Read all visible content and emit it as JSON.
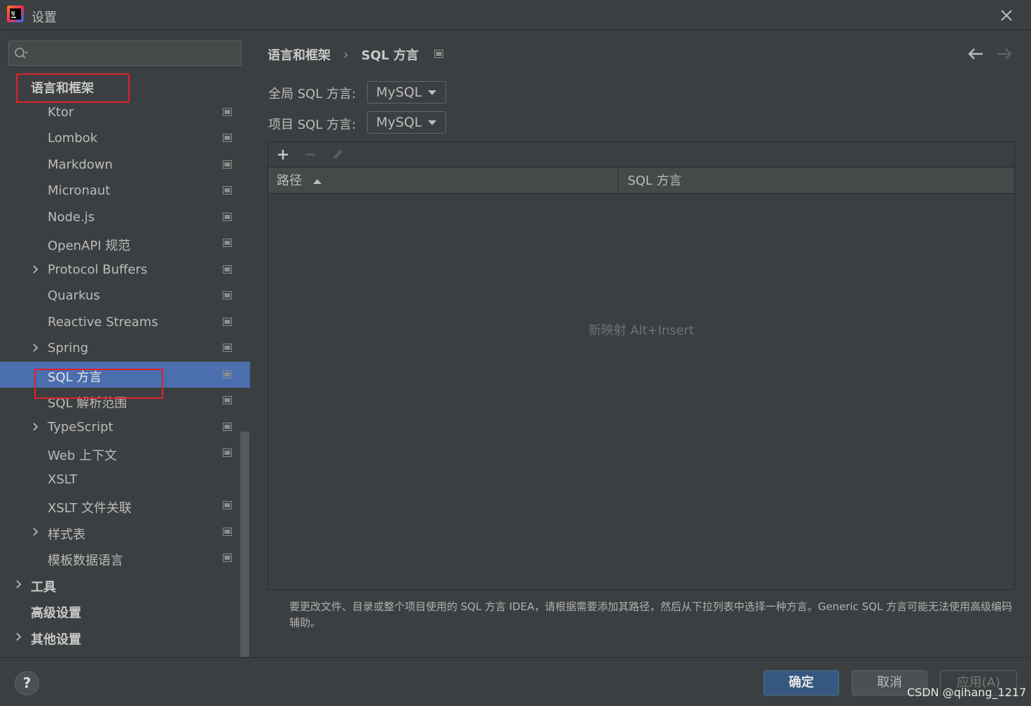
{
  "window": {
    "title": "设置",
    "close_icon": "close-icon"
  },
  "sidebar": {
    "search": {
      "value": "",
      "placeholder": ""
    },
    "items": [
      {
        "label": "语言和框架",
        "level": 0,
        "bold": true,
        "expandable": false,
        "project_icon": false
      },
      {
        "label": "Ktor",
        "level": 1,
        "expandable": false,
        "project_icon": true
      },
      {
        "label": "Lombok",
        "level": 1,
        "expandable": false,
        "project_icon": true
      },
      {
        "label": "Markdown",
        "level": 1,
        "expandable": false,
        "project_icon": true
      },
      {
        "label": "Micronaut",
        "level": 1,
        "expandable": false,
        "project_icon": true
      },
      {
        "label": "Node.js",
        "level": 1,
        "expandable": false,
        "project_icon": true
      },
      {
        "label": "OpenAPI 规范",
        "level": 1,
        "expandable": false,
        "project_icon": true
      },
      {
        "label": "Protocol Buffers",
        "level": 1,
        "expandable": true,
        "project_icon": true
      },
      {
        "label": "Quarkus",
        "level": 1,
        "expandable": false,
        "project_icon": true
      },
      {
        "label": "Reactive Streams",
        "level": 1,
        "expandable": false,
        "project_icon": true
      },
      {
        "label": "Spring",
        "level": 1,
        "expandable": true,
        "project_icon": true
      },
      {
        "label": "SQL 方言",
        "level": 1,
        "expandable": false,
        "project_icon": true,
        "selected": true
      },
      {
        "label": "SQL 解析范围",
        "level": 1,
        "expandable": false,
        "project_icon": true
      },
      {
        "label": "TypeScript",
        "level": 1,
        "expandable": true,
        "project_icon": true
      },
      {
        "label": "Web 上下文",
        "level": 1,
        "expandable": false,
        "project_icon": true
      },
      {
        "label": "XSLT",
        "level": 1,
        "expandable": false,
        "project_icon": false
      },
      {
        "label": "XSLT 文件关联",
        "level": 1,
        "expandable": false,
        "project_icon": true
      },
      {
        "label": "样式表",
        "level": 1,
        "expandable": true,
        "project_icon": true
      },
      {
        "label": "模板数据语言",
        "level": 1,
        "expandable": false,
        "project_icon": true
      },
      {
        "label": "工具",
        "level": 0,
        "bold": true,
        "expandable": true,
        "project_icon": false
      },
      {
        "label": "高级设置",
        "level": 0,
        "bold": true,
        "expandable": false,
        "project_icon": false
      },
      {
        "label": "其他设置",
        "level": 0,
        "bold": true,
        "expandable": true,
        "project_icon": false
      }
    ]
  },
  "main": {
    "breadcrumb": {
      "parent": "语言和框架",
      "separator": "›",
      "current": "SQL 方言"
    },
    "global_dialect": {
      "label": "全局 SQL 方言:",
      "value": "MySQL"
    },
    "project_dialect": {
      "label": "项目 SQL 方言:",
      "value": "MySQL"
    },
    "table": {
      "columns": [
        "路径",
        "SQL 方言"
      ],
      "rows": [],
      "empty_text": "新映射 Alt+Insert"
    },
    "help_text": "要更改文件、目录或整个项目使用的 SQL 方言 IDEA，请根据需要添加其路径，然后从下拉列表中选择一种方言。Generic SQL 方言可能无法使用高级编码辅助。"
  },
  "footer": {
    "help_label": "?",
    "ok_label": "确定",
    "cancel_label": "取消",
    "apply_label": "应用(A)",
    "watermark": "CSDN @qihang_1217"
  },
  "colors": {
    "background": "#3c3f41",
    "selection": "#4b6eaf",
    "primary_button": "#365880",
    "highlight_box": "#e0202a"
  }
}
